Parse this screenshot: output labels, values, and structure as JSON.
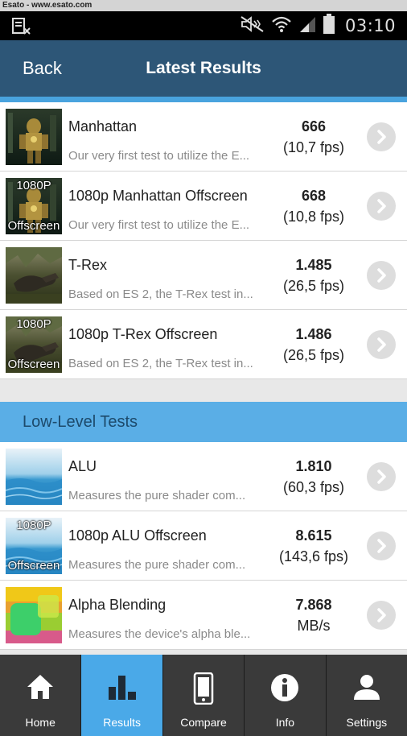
{
  "watermark": "Esato - www.esato.com",
  "status": {
    "time": "03:10"
  },
  "header": {
    "back_label": "Back",
    "title": "Latest Results"
  },
  "tests": [
    {
      "title": "Manhattan",
      "description": "Our very first test to utilize the E...",
      "score": "666",
      "fps": "(10,7 fps)",
      "thumb": "manhattan",
      "thumb_labels": []
    },
    {
      "title": "1080p Manhattan Offscreen",
      "description": "Our very first test to utilize the E...",
      "score": "668",
      "fps": "(10,8 fps)",
      "thumb": "manhattan",
      "thumb_labels": [
        "1080P",
        "Offscreen"
      ]
    },
    {
      "title": "T-Rex",
      "description": "Based on ES 2, the T-Rex test in...",
      "score": "1.485",
      "fps": "(26,5 fps)",
      "thumb": "trex",
      "thumb_labels": []
    },
    {
      "title": "1080p T-Rex Offscreen",
      "description": "Based on ES 2, the T-Rex test in...",
      "score": "1.486",
      "fps": "(26,5 fps)",
      "thumb": "trex",
      "thumb_labels": [
        "1080P",
        "Offscreen"
      ]
    }
  ],
  "section": {
    "title": "Low-Level Tests"
  },
  "low_level": [
    {
      "title": "ALU",
      "description": "Measures the pure shader com...",
      "score": "1.810",
      "fps": "(60,3 fps)",
      "thumb": "alu",
      "thumb_labels": []
    },
    {
      "title": "1080p ALU Offscreen",
      "description": "Measures the pure shader com...",
      "score": "8.615",
      "fps": "(143,6 fps)",
      "thumb": "alu",
      "thumb_labels": [
        "1080P",
        "Offscreen"
      ]
    },
    {
      "title": "Alpha Blending",
      "description": "Measures the device's alpha ble...",
      "score": "7.868",
      "fps": "MB/s",
      "thumb": "alpha",
      "thumb_labels": []
    }
  ],
  "tabs": [
    {
      "label": "Home",
      "icon": "home-icon",
      "active": false
    },
    {
      "label": "Results",
      "icon": "bar-chart-icon",
      "active": true
    },
    {
      "label": "Compare",
      "icon": "phone-icon",
      "active": false
    },
    {
      "label": "Info",
      "icon": "info-icon",
      "active": false
    },
    {
      "label": "Settings",
      "icon": "user-icon",
      "active": false
    }
  ],
  "colors": {
    "app_bar": "#2d5677",
    "accent": "#4aa9e8",
    "section": "#5aaee6",
    "tab_bg": "#3a3a3a"
  }
}
